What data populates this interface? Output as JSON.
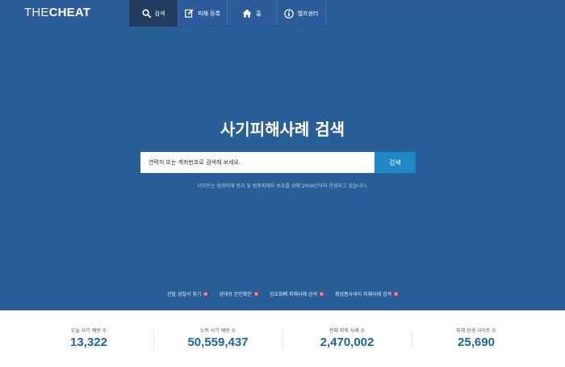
{
  "header": {
    "logo_part1": "THE",
    "logo_part2": "CHEAT",
    "nav": [
      {
        "label": "검색",
        "icon": "search-icon"
      },
      {
        "label": "피해 등록",
        "icon": "edit-icon"
      },
      {
        "label": "홈",
        "icon": "home-icon"
      },
      {
        "label": "헬프센터",
        "icon": "info-icon"
      }
    ]
  },
  "hero": {
    "title": "사기피해사례 검색",
    "search_placeholder": "연락처 또는 계좌번호로 검색해 보세요.",
    "search_button": "검색",
    "description": "더치트는 범죄피해 방지 및 범죄피해자 보호를 위해 2006년부터 운영되고 있습니다.",
    "quick_links": [
      {
        "label": "관할 경찰서 찾기",
        "badge": "N"
      },
      {
        "label": "상태방 본인확인",
        "badge": "N"
      },
      {
        "label": "암호화폐 피해사례 검색",
        "badge": "N"
      },
      {
        "label": "취업종사데이 피해사례 검색",
        "badge": "N"
      }
    ]
  },
  "stats": [
    {
      "label": "오늘 사기 예방 수",
      "value": "13,322"
    },
    {
      "label": "누적 사기 예방 수",
      "value": "50,559,437"
    },
    {
      "label": "전체 피해 사례 수",
      "value": "2,470,002"
    },
    {
      "label": "피해 방생 사이트 수",
      "value": "25,690"
    }
  ],
  "colors": {
    "nav_bg": "#2c5c99",
    "nav_active": "#223b5e",
    "hero_bg": "#295f99",
    "search_button": "#1f89c8",
    "stat_value": "#1e63a6"
  }
}
